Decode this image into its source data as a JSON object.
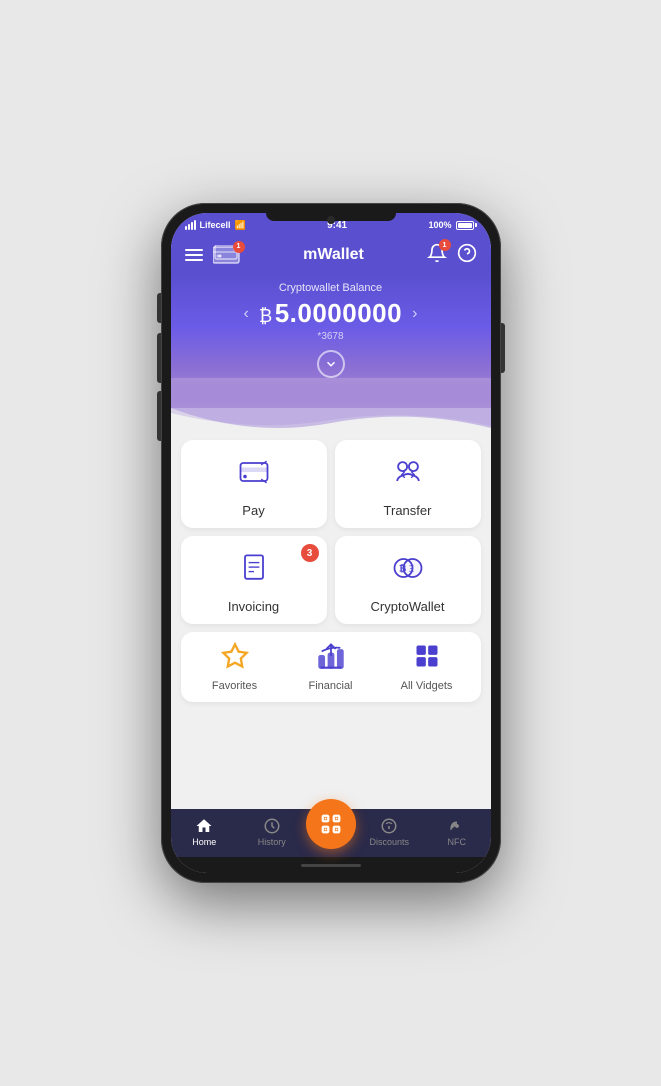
{
  "status": {
    "carrier": "Lifecell",
    "time": "9:41",
    "battery": "100%"
  },
  "header": {
    "title": "mWallet",
    "notification_badge": "1"
  },
  "balance": {
    "label": "Cryptowallet Balance",
    "currency_symbol": "₿",
    "amount": "5.0000000",
    "account": "*3678"
  },
  "actions": [
    {
      "id": "pay",
      "label": "Pay",
      "badge": null
    },
    {
      "id": "transfer",
      "label": "Transfer",
      "badge": null
    },
    {
      "id": "invoicing",
      "label": "Invoicing",
      "badge": "3"
    },
    {
      "id": "cryptowallet",
      "label": "CryptoWallet",
      "badge": null
    }
  ],
  "widgets": [
    {
      "id": "favorites",
      "label": "Favorites",
      "icon_type": "star",
      "color": "orange"
    },
    {
      "id": "financial",
      "label": "Financial",
      "icon_type": "bank",
      "color": "purple"
    },
    {
      "id": "all_vidgets",
      "label": "All Vidgets",
      "icon_type": "grid",
      "color": "purple"
    }
  ],
  "bottom_nav": [
    {
      "id": "home",
      "label": "Home",
      "active": true
    },
    {
      "id": "history",
      "label": "History",
      "active": false
    },
    {
      "id": "scan",
      "label": "",
      "active": false,
      "center": true
    },
    {
      "id": "discounts",
      "label": "Discounts",
      "active": false
    },
    {
      "id": "nfc",
      "label": "NFC",
      "active": false
    }
  ]
}
